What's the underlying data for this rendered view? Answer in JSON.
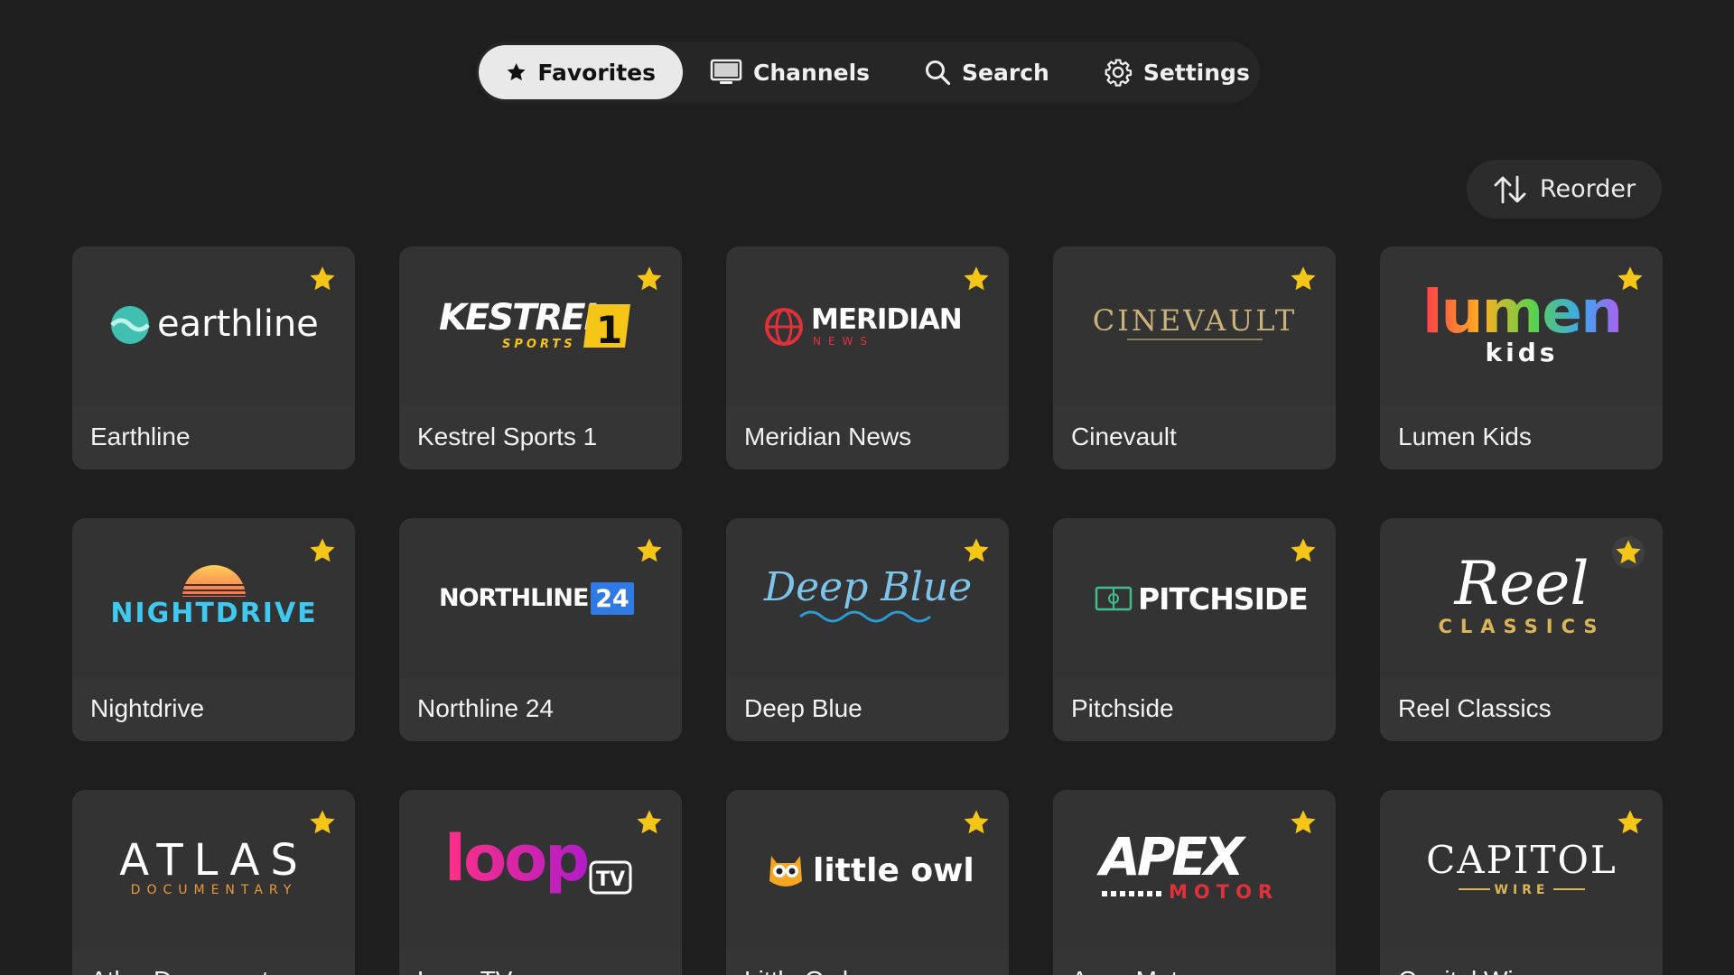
{
  "nav": {
    "tabs": [
      {
        "label": "Favorites",
        "icon": "star-icon",
        "active": true
      },
      {
        "label": "Channels",
        "icon": "tv-icon",
        "active": false
      },
      {
        "label": "Search",
        "icon": "search-icon",
        "active": false
      },
      {
        "label": "Settings",
        "icon": "gear-icon",
        "active": false
      }
    ]
  },
  "reorder": {
    "label": "Reorder",
    "icon": "sort-arrows-icon"
  },
  "colors": {
    "background": "#1e1e1f",
    "card": "#333334",
    "star": "#f5c518",
    "active_tab": "#e9e9ea"
  },
  "channels": [
    {
      "name": "Earthline",
      "logo_text": "earthline",
      "favorite": true
    },
    {
      "name": "Kestrel Sports 1",
      "logo_text": "KESTREL",
      "logo_sub": "SPORTS",
      "logo_badge": "1",
      "favorite": true
    },
    {
      "name": "Meridian News",
      "logo_text": "MERIDIAN",
      "logo_sub": "NEWS",
      "favorite": true
    },
    {
      "name": "Cinevault",
      "logo_text": "CINEVAULT",
      "favorite": true
    },
    {
      "name": "Lumen Kids",
      "logo_text": "lumen",
      "logo_sub": "kids",
      "favorite": true
    },
    {
      "name": "Nightdrive",
      "logo_text": "NIGHTDRIVE",
      "favorite": true
    },
    {
      "name": "Northline 24",
      "logo_text": "NORTHLINE",
      "logo_badge": "24",
      "favorite": true
    },
    {
      "name": "Deep Blue",
      "logo_text": "Deep Blue",
      "favorite": true
    },
    {
      "name": "Pitchside",
      "logo_text": "PITCHSIDE",
      "favorite": true
    },
    {
      "name": "Reel Classics",
      "logo_text": "Reel",
      "logo_sub": "CLASSICS",
      "favorite": true
    },
    {
      "name": "Atlas Documentary",
      "logo_text": "ATLAS",
      "logo_sub": "DOCUMENTARY",
      "favorite": true
    },
    {
      "name": "Loop TV",
      "logo_text": "loop",
      "logo_badge": "TV",
      "favorite": true
    },
    {
      "name": "Little Owl",
      "logo_text": "little owl",
      "favorite": true
    },
    {
      "name": "Apex Motor",
      "logo_text": "APEX",
      "logo_sub": "MOTOR",
      "favorite": true
    },
    {
      "name": "Capitol Wire",
      "logo_text": "CAPITOL",
      "logo_sub": "WIRE",
      "favorite": true
    }
  ]
}
